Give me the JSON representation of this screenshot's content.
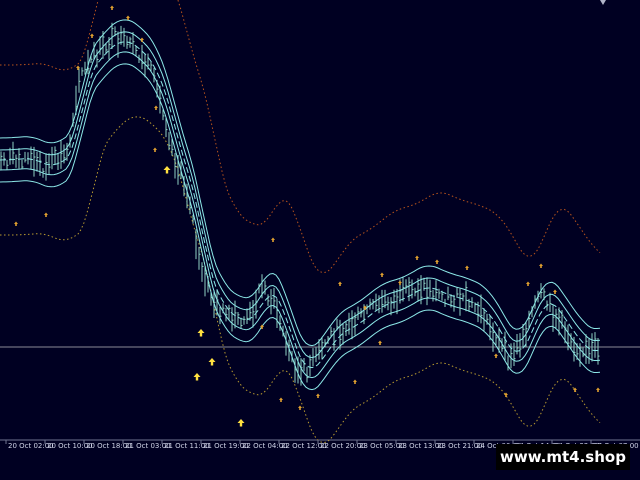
{
  "time_axis": {
    "labels": [
      "20 Oct 02:00",
      "20 Oct 10:00",
      "20 Oct 18:00",
      "21 Oct 03:00",
      "21 Oct 11:00",
      "21 Oct 19:00",
      "22 Oct 04:00",
      "22 Oct 12:00",
      "22 Oct 20:00",
      "23 Oct 05:00",
      "23 Oct 13:00",
      "23 Oct 21:00",
      "24 Oct 06:00",
      "24 Oct 14:00",
      "24 Oct 22:00",
      "27 Oct 07:00"
    ]
  },
  "watermark": {
    "text": "www.mt4.shop"
  },
  "colors": {
    "background": "#000022",
    "bars": "#8fd2c4",
    "bands": "#8ce8e8",
    "outer_dots": "#b8531c",
    "lower_dots": "#b89a30",
    "arrows_up": "#ffe040",
    "arrows_small": "#e0a030",
    "horizontal_line": "#8a8a95"
  },
  "icons": {
    "scroll_marker": "triangle-marker-icon",
    "buy_signal": "up-arrow-icon",
    "fractal": "small-arrow-icon"
  }
}
